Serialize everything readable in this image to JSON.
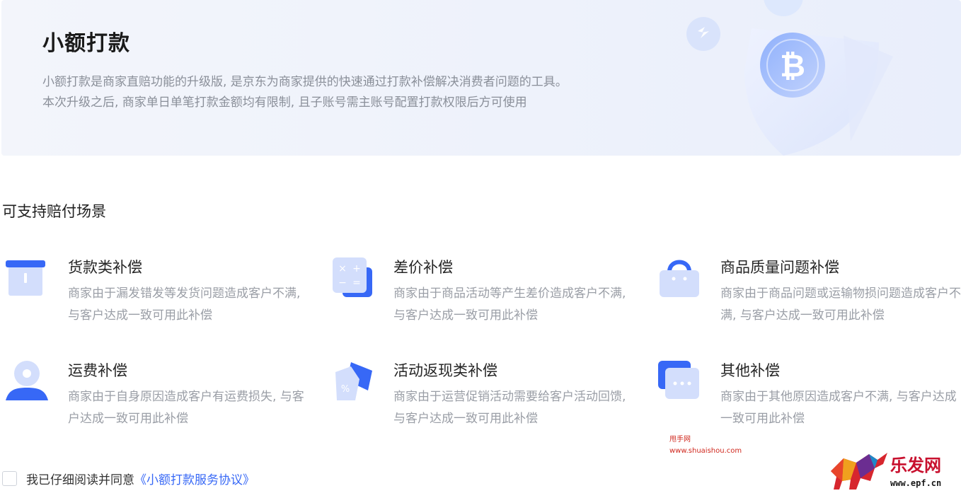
{
  "banner": {
    "title": "小额打款",
    "desc_line1": "小额打款是商家直赔功能的升级版, 是京东为商家提供的快速通过打款补偿解决消费者问题的工具。",
    "desc_line2": "本次升级之后, 商家单日单笔打款金额均有限制, 且子账号需主账号配置打款权限后方可使用",
    "illustration": "shield-bitcoin-icon"
  },
  "section": {
    "title": "可支持赔付场景"
  },
  "scenarios": [
    {
      "title": "货款类补偿",
      "desc": "商家由于漏发错发等发货问题造成客户不满, 与客户达成一致可用此补偿",
      "icon": "box-icon"
    },
    {
      "title": "差价补偿",
      "desc": "商家由于商品活动等产生差价造成客户不满, 与客户达成一致可用此补偿",
      "icon": "calculator-icon"
    },
    {
      "title": "商品质量问题补偿",
      "desc": "商家由于商品问题或运输物损问题造成客户不满, 与客户达成一致可用此补偿",
      "icon": "shopping-bag-icon"
    },
    {
      "title": "运费补偿",
      "desc": "商家由于自身原因造成客户有运费损失, 与客户达成一致可用此补偿",
      "icon": "location-pin-icon"
    },
    {
      "title": "活动返现类补偿",
      "desc": "商家由于运营促销活动需要给客户活动回馈, 与客户达成一致可用此补偿",
      "icon": "discount-tag-icon"
    },
    {
      "title": "其他补偿",
      "desc": "商家由于其他原因造成客户不满, 与客户达成一致可用此补偿",
      "icon": "more-chat-icon"
    }
  ],
  "agreement": {
    "text": "我已仔细阅读并同意",
    "link": "《小额打款服务协议》",
    "checked": false
  },
  "watermarks": {
    "site_name": "甩手网",
    "site_url": "www.shuaishou.com",
    "logo_text": "乐发网",
    "logo_url": "www.epf.cn"
  },
  "colors": {
    "accent": "#3768f6",
    "icon_light": "#c9d6fb",
    "text_muted": "#9a9ea6"
  }
}
